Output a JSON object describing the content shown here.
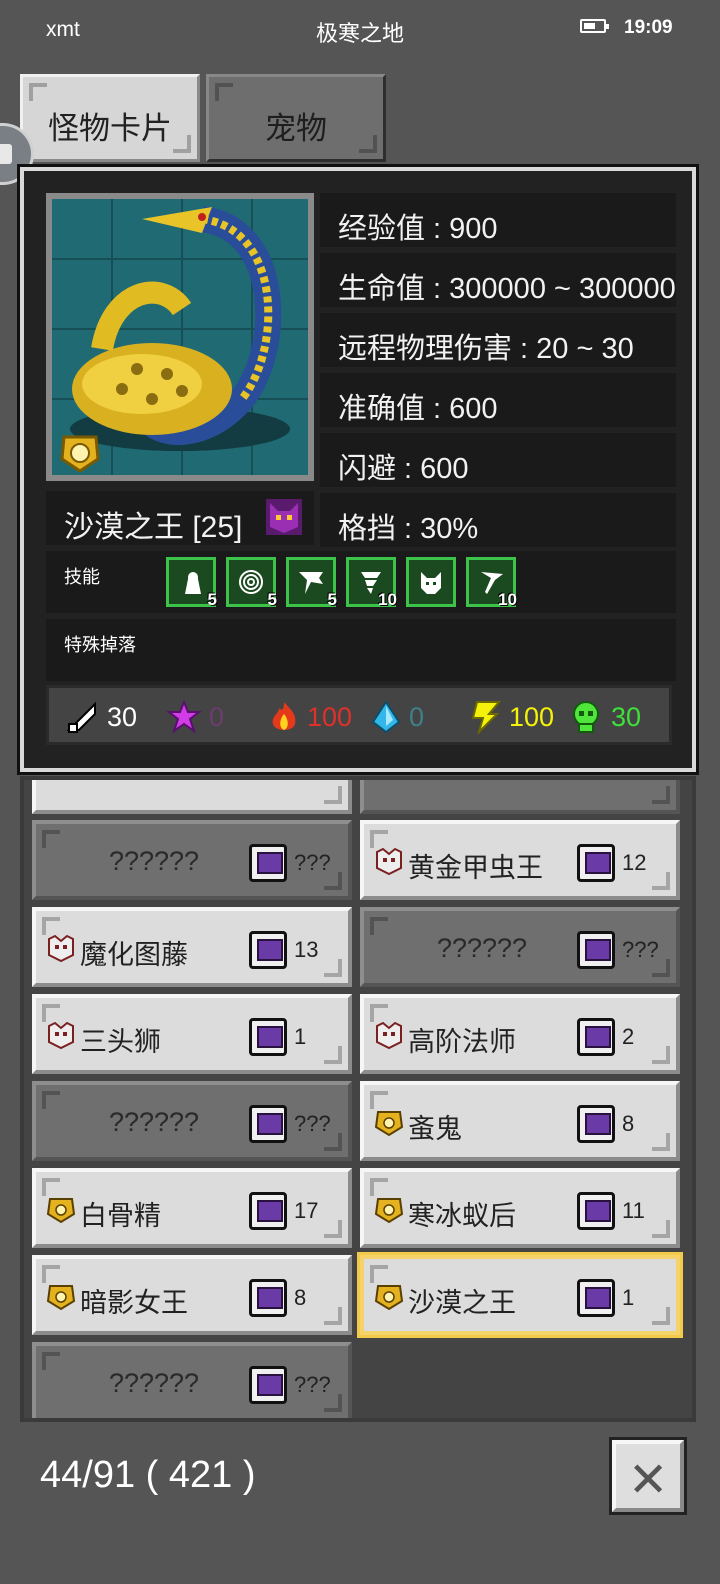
{
  "status_bar": {
    "carrier": "xmt",
    "location": "极寒之地",
    "battery_level": 0.6,
    "time": "19:09"
  },
  "tabs": [
    {
      "label": "怪物卡片",
      "active": true
    },
    {
      "label": "宠物",
      "active": false
    }
  ],
  "monster": {
    "name": "沙漠之王 [25]",
    "stats": [
      "经验值 : 900",
      "生命值 : 300000 ~ 300000",
      "远程物理伤害 : 20 ~ 30",
      "准确值 : 600",
      "闪避 : 600",
      "格挡 : 30%"
    ],
    "skills_label": "技能",
    "skills": [
      {
        "icon": "hooded-figure-icon",
        "level": "5"
      },
      {
        "icon": "spiral-icon",
        "level": "5"
      },
      {
        "icon": "shatter-icon",
        "level": "5"
      },
      {
        "icon": "tornado-icon",
        "level": "10"
      },
      {
        "icon": "beast-summon-icon",
        "level": ""
      },
      {
        "icon": "hammer-strike-icon",
        "level": "10"
      }
    ],
    "drops_label": "特殊掉落",
    "resistances": [
      {
        "icon": "physical-icon",
        "value": "30",
        "color": "#ffffff"
      },
      {
        "icon": "arcane-icon",
        "value": "0",
        "color": "#6b3d6f"
      },
      {
        "icon": "fire-icon",
        "value": "100",
        "color": "#e0302a"
      },
      {
        "icon": "ice-icon",
        "value": "0",
        "color": "#3f7f8a"
      },
      {
        "icon": "lightning-icon",
        "value": "100",
        "color": "#f4f20a"
      },
      {
        "icon": "poison-icon",
        "value": "30",
        "color": "#3fe03a"
      }
    ]
  },
  "list": {
    "items": [
      {
        "name": "??????",
        "count": "???",
        "unknown": true,
        "rank": "none"
      },
      {
        "name": "黄金甲虫王",
        "count": "12",
        "unknown": false,
        "rank": "elite"
      },
      {
        "name": "魔化图藤",
        "count": "13",
        "unknown": false,
        "rank": "elite"
      },
      {
        "name": "??????",
        "count": "???",
        "unknown": true,
        "rank": "none"
      },
      {
        "name": "三头狮",
        "count": "1",
        "unknown": false,
        "rank": "elite"
      },
      {
        "name": "高阶法师",
        "count": "2",
        "unknown": false,
        "rank": "elite"
      },
      {
        "name": "??????",
        "count": "???",
        "unknown": true,
        "rank": "none"
      },
      {
        "name": "蚉鬼",
        "count": "8",
        "unknown": false,
        "rank": "boss"
      },
      {
        "name": "白骨精",
        "count": "17",
        "unknown": false,
        "rank": "boss"
      },
      {
        "name": "寒冰蚁后",
        "count": "11",
        "unknown": false,
        "rank": "boss"
      },
      {
        "name": "暗影女王",
        "count": "8",
        "unknown": false,
        "rank": "boss"
      },
      {
        "name": "沙漠之王",
        "count": "1",
        "unknown": false,
        "rank": "boss",
        "selected": true
      },
      {
        "name": "??????",
        "count": "???",
        "unknown": true,
        "rank": "none"
      }
    ]
  },
  "footer": {
    "collection_count": "44/91 ( 421 )"
  },
  "colors": {
    "background": "#555555",
    "selected_border": "#f3c94a",
    "skill_border": "#3cc34a"
  }
}
